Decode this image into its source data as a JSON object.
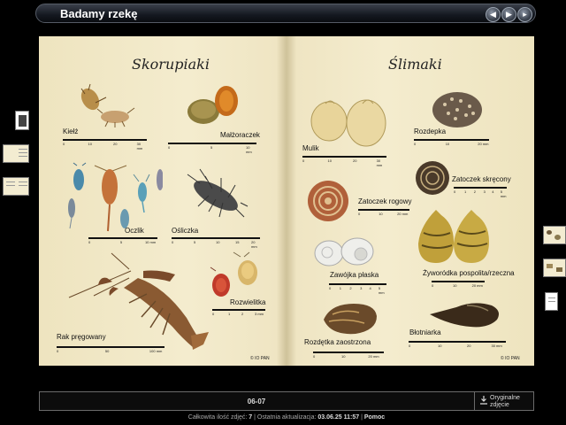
{
  "window": {
    "title": "Badamy rzekę"
  },
  "book": {
    "left_page": {
      "title": "Skorupiaki",
      "labels": [
        "Kiełż",
        "Małżoraczek",
        "Oczlik",
        "Ośliczka",
        "Rak pręgowany",
        "Rozwielitka"
      ],
      "copyright": "© IO PAN"
    },
    "right_page": {
      "title": "Ślimaki",
      "labels": [
        "Mulik",
        "Rozdepka",
        "Zatoczek rogowy",
        "Zatoczek skręcony",
        "Zawójka płaska",
        "Żyworódka pospolita/rzeczna",
        "Rozdętka zaostrzona",
        "Błotniarka"
      ],
      "copyright": "© IO PAN"
    },
    "scale_units": "mm"
  },
  "pager": {
    "page_numbers": "06-07"
  },
  "download": {
    "label_line1": "Oryginalne",
    "label_line2": "zdjęcie"
  },
  "status": {
    "total_label": "Całkowita ilość zdjęć:",
    "total_value": "7",
    "updated_label": "Ostatnia aktualizacja:",
    "updated_value": "03.06.25 11:57",
    "help": "Pomoc",
    "separator": "|"
  }
}
